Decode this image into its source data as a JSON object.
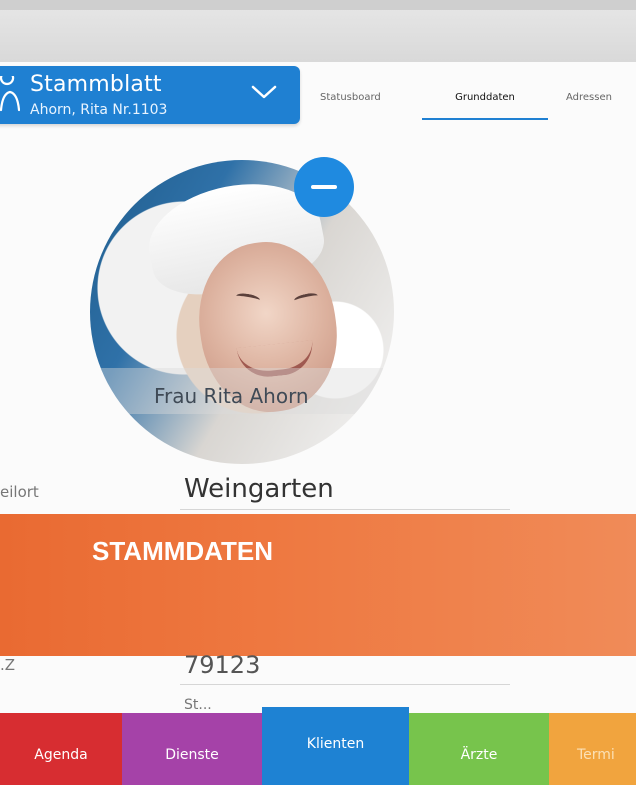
{
  "header": {
    "title": "Stammblatt",
    "subtitle": "Ahorn, Rita Nr.1103"
  },
  "tabs": [
    {
      "label": "Statusboard"
    },
    {
      "label": "Grunddaten",
      "active": true
    },
    {
      "label": "Adressen"
    }
  ],
  "profile": {
    "name": "Frau Rita Ahorn"
  },
  "fields": {
    "top_label": "eilort",
    "top_value": "Weingarten",
    "bottom_label": ".Z",
    "bottom_value": "79123",
    "partial_next": "St..."
  },
  "banner": {
    "label": "STAMMDATEN"
  },
  "bottom_nav": [
    {
      "label": "Agenda",
      "color": "#d72d31"
    },
    {
      "label": "Dienste",
      "color": "#a542a8"
    },
    {
      "label": "Klienten",
      "color": "#1e82d3",
      "active": true
    },
    {
      "label": "Ärzte",
      "color": "#77c44c"
    },
    {
      "label": "Termi",
      "color": "#f1a43e"
    }
  ],
  "colors": {
    "primary": "#1f80d2",
    "banner": "#ee7840"
  }
}
